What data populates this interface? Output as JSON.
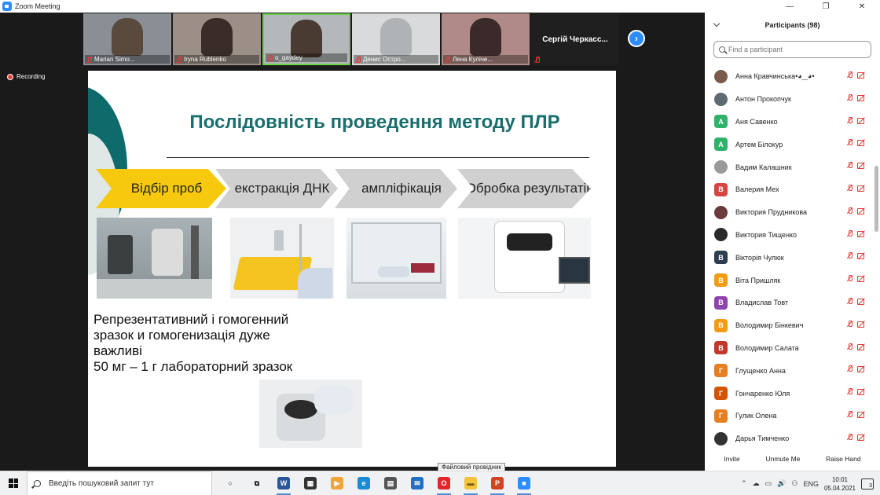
{
  "window": {
    "title": "Zoom Meeting",
    "controls": [
      "—",
      "❐",
      "✕"
    ]
  },
  "gallery": [
    {
      "name": "Marian Simo...",
      "bg": "#8a8f96",
      "blob": "#5a4a3e"
    },
    {
      "name": "Iryna Rublenko",
      "bg": "#9c8f88",
      "blob": "#3a2c28"
    },
    {
      "name": "o_gaydey",
      "bg": "#b4b8ba",
      "blob": "#4a3b32"
    },
    {
      "name": "Денис Остро...",
      "bg": "#d9dadb",
      "blob": "#b0b3b6"
    },
    {
      "name": "Лена Куліче...",
      "bg": "#b08a86",
      "blob": "#3c2a2a"
    }
  ],
  "gallery_name_only": "Сергій Черкасс...",
  "recording_label": "Recording",
  "slide": {
    "title": "Послідовність проведення методу ПЛР",
    "steps": [
      "Відбір проб",
      "екстракція ДНК",
      "ампліфікація",
      "Обробка результатів"
    ],
    "text_lines": [
      "Репрезентативний і гомогенний",
      "зразок  и гомогенизація дуже",
      "важливі",
      "50 мг – 1 г лабораторний зразок"
    ]
  },
  "tooltip": "Файловий провідник",
  "panel": {
    "title": "Participants (98)",
    "search_placeholder": "Find a participant",
    "participants": [
      {
        "name": "Анна Кравчинська•◕‿◕•",
        "avatar": "",
        "color": "#7a5a4a",
        "photo": true
      },
      {
        "name": "Антон Прокопчук",
        "avatar": "",
        "color": "#5d6a70",
        "photo": true
      },
      {
        "name": "Аня Савенко",
        "avatar": "А",
        "color": "#2fb36a",
        "photo": false
      },
      {
        "name": "Артем Білокур",
        "avatar": "А",
        "color": "#2fb36a",
        "photo": false
      },
      {
        "name": "Вадим Калашник",
        "avatar": "",
        "color": "#9a9a9a",
        "photo": true
      },
      {
        "name": "Валерия Мех",
        "avatar": "В",
        "color": "#d64541",
        "photo": false
      },
      {
        "name": "Виктория Прудникова",
        "avatar": "",
        "color": "#6b3a3a",
        "photo": true
      },
      {
        "name": "Виктория Тищенко",
        "avatar": "",
        "color": "#2a2a2a",
        "photo": true
      },
      {
        "name": "Вікторія Чулюк",
        "avatar": "В",
        "color": "#2c3e50",
        "photo": false
      },
      {
        "name": "Віта Пришляк",
        "avatar": "В",
        "color": "#f39c12",
        "photo": false
      },
      {
        "name": "Владислав Товт",
        "avatar": "В",
        "color": "#8e44ad",
        "photo": false
      },
      {
        "name": "Володимир Бінкевич",
        "avatar": "В",
        "color": "#f39c12",
        "photo": false
      },
      {
        "name": "Володимир Салата",
        "avatar": "В",
        "color": "#c0392b",
        "photo": false
      },
      {
        "name": "Глущенко Анна",
        "avatar": "Г",
        "color": "#e67e22",
        "photo": false
      },
      {
        "name": "Гончаренко Юля",
        "avatar": "Г",
        "color": "#d35400",
        "photo": false
      },
      {
        "name": "Гулик Олена",
        "avatar": "Г",
        "color": "#e67e22",
        "photo": false
      },
      {
        "name": "Дарья Тимченко",
        "avatar": "",
        "color": "#333333",
        "photo": true
      }
    ],
    "footer": {
      "invite": "Invite",
      "unmute": "Unmute Me",
      "raise": "Raise Hand"
    }
  },
  "taskbar": {
    "search_placeholder": "Введіть пошуковий запит тут",
    "apps": [
      {
        "name": "cortana",
        "glyph": "○",
        "color": "transparent",
        "text_color": "#111"
      },
      {
        "name": "task-view",
        "glyph": "⧉",
        "color": "transparent",
        "text_color": "#111"
      },
      {
        "name": "word",
        "glyph": "W",
        "color": "#2b579a",
        "text_color": "#fff"
      },
      {
        "name": "store",
        "glyph": "▦",
        "color": "#333",
        "text_color": "#fff"
      },
      {
        "name": "media",
        "glyph": "▶",
        "color": "#f2a33a",
        "text_color": "#fff"
      },
      {
        "name": "edge",
        "glyph": "e",
        "color": "#1c8bd6",
        "text_color": "#fff"
      },
      {
        "name": "calculator",
        "glyph": "▤",
        "color": "#555",
        "text_color": "#fff"
      },
      {
        "name": "mail",
        "glyph": "✉",
        "color": "#1f6fc4",
        "text_color": "#fff"
      },
      {
        "name": "opera",
        "glyph": "O",
        "color": "#e3262b",
        "text_color": "#fff"
      },
      {
        "name": "file-explorer",
        "glyph": "▬",
        "color": "#f3c33c",
        "text_color": "#7a5a10"
      },
      {
        "name": "powerpoint",
        "glyph": "P",
        "color": "#d04423",
        "text_color": "#fff"
      },
      {
        "name": "zoom",
        "glyph": "■",
        "color": "#2d8cff",
        "text_color": "#fff"
      }
    ],
    "tray_icons": [
      "⌃",
      "☁",
      "▭",
      "🔊",
      "⚇",
      "ENG"
    ],
    "time": "10:01",
    "date": "05.04.2021",
    "notifications": "3"
  }
}
